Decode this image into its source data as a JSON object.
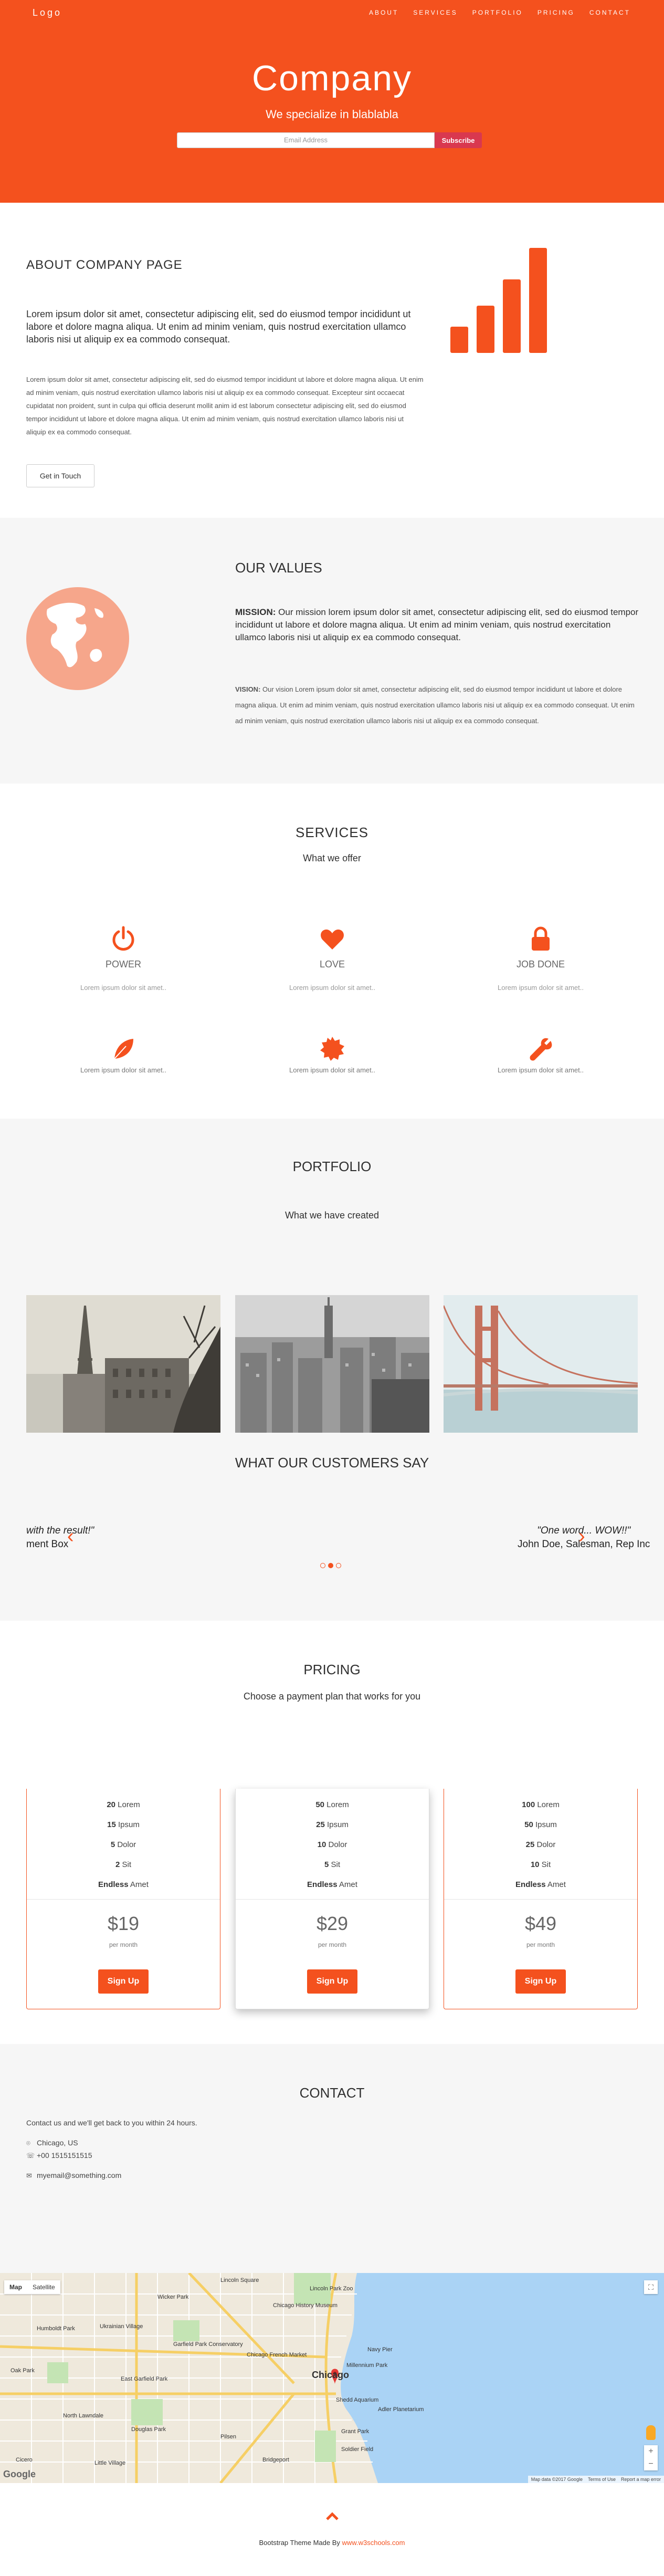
{
  "nav": {
    "logo": "Logo",
    "links": [
      "ABOUT",
      "SERVICES",
      "PORTFOLIO",
      "PRICING",
      "CONTACT"
    ]
  },
  "hero": {
    "title": "Company",
    "tagline": "We specialize in blablabla",
    "email_placeholder": "Email Address",
    "subscribe_label": "Subscribe"
  },
  "about": {
    "title": "ABOUT COMPANY PAGE",
    "lead": "Lorem ipsum dolor sit amet, consectetur adipiscing elit, sed do eiusmod tempor incididunt ut labore et dolore magna aliqua. Ut enim ad minim veniam, quis nostrud exercitation ullamco laboris nisi ut aliquip ex ea commodo consequat.",
    "body": "Lorem ipsum dolor sit amet, consectetur adipiscing elit, sed do eiusmod tempor incididunt ut labore et dolore magna aliqua. Ut enim ad minim veniam, quis nostrud exercitation ullamco laboris nisi ut aliquip ex ea commodo consequat. Excepteur sint occaecat cupidatat non proident, sunt in culpa qui officia deserunt mollit anim id est laborum consectetur adipiscing elit, sed do eiusmod tempor incididunt ut labore et dolore magna aliqua. Ut enim ad minim veniam, quis nostrud exercitation ullamco laboris nisi ut aliquip ex ea commodo consequat.",
    "button_label": "Get in Touch",
    "icon": "signal-icon"
  },
  "values": {
    "title": "OUR VALUES",
    "mission_label": "MISSION:",
    "mission_text": " Our mission lorem ipsum dolor sit amet, consectetur adipiscing elit, sed do eiusmod tempor incididunt ut labore et dolore magna aliqua. Ut enim ad minim veniam, quis nostrud exercitation ullamco laboris nisi ut aliquip ex ea commodo consequat.",
    "vision_label": "VISION:",
    "vision_text": " Our vision Lorem ipsum dolor sit amet, consectetur adipiscing elit, sed do eiusmod tempor incididunt ut labore et dolore magna aliqua. Ut enim ad minim veniam, quis nostrud exercitation ullamco laboris nisi ut aliquip ex ea commodo consequat. Ut enim ad minim veniam, quis nostrud exercitation ullamco laboris nisi ut aliquip ex ea commodo consequat.",
    "icon": "globe-icon"
  },
  "services": {
    "title": "SERVICES",
    "subtitle": "What we offer",
    "items": [
      {
        "icon": "power-icon",
        "title": "POWER",
        "text": "Lorem ipsum dolor sit amet.."
      },
      {
        "icon": "heart-icon",
        "title": "LOVE",
        "text": "Lorem ipsum dolor sit amet.."
      },
      {
        "icon": "lock-icon",
        "title": "JOB DONE",
        "text": "Lorem ipsum dolor sit amet.."
      },
      {
        "icon": "leaf-icon",
        "title": "",
        "text": "Lorem ipsum dolor sit amet.."
      },
      {
        "icon": "certificate-icon",
        "title": "",
        "text": "Lorem ipsum dolor sit amet.."
      },
      {
        "icon": "wrench-icon",
        "title": "",
        "text": "Lorem ipsum dolor sit amet.."
      }
    ]
  },
  "portfolio": {
    "title": "PORTFOLIO",
    "subtitle": "What we have created",
    "images": [
      "paris-photo",
      "new-york-photo",
      "san-francisco-photo"
    ],
    "customers_title": "WHAT OUR CUSTOMERS SAY",
    "quote_left_line1": "with the result!\"",
    "quote_left_line2": "ment Box",
    "quote_right_line1": "\"One word... WOW!!\"",
    "quote_right_line2": "John Doe, Salesman, Rep Inc"
  },
  "pricing": {
    "title": "PRICING",
    "subtitle": "Choose a payment plan that works for you",
    "plans": [
      {
        "f1n": "20",
        "f1": " Lorem",
        "f2n": "15",
        "f2": " Ipsum",
        "f3n": "5",
        "f3": " Dolor",
        "f4n": "2",
        "f4": " Sit",
        "f5n": "Endless",
        "f5": " Amet",
        "price": "$19",
        "per": "per month",
        "button": "Sign Up"
      },
      {
        "f1n": "50",
        "f1": " Lorem",
        "f2n": "25",
        "f2": " Ipsum",
        "f3n": "10",
        "f3": " Dolor",
        "f4n": "5",
        "f4": " Sit",
        "f5n": "Endless",
        "f5": " Amet",
        "price": "$29",
        "per": "per month",
        "button": "Sign Up"
      },
      {
        "f1n": "100",
        "f1": " Lorem",
        "f2n": "50",
        "f2": " Ipsum",
        "f3n": "25",
        "f3": " Dolor",
        "f4n": "10",
        "f4": " Sit",
        "f5n": "Endless",
        "f5": " Amet",
        "price": "$49",
        "per": "per month",
        "button": "Sign Up"
      }
    ]
  },
  "contact": {
    "title": "CONTACT",
    "intro": "Contact us and we'll get back to you within 24 hours.",
    "location": "Chicago, US",
    "phone": "+00 1515151515",
    "email": "myemail@something.com"
  },
  "map": {
    "tab_map": "Map",
    "tab_satellite": "Satellite",
    "city": "Chicago",
    "labels": [
      "Lincoln Park Zoo",
      "Chicago History Museum",
      "Navy Pier",
      "Millennium Park",
      "Shedd Aquarium",
      "Adler Planetarium",
      "Grant Park",
      "Garfield Park Conservatory",
      "Douglas Park",
      "Little Village",
      "Ukrainian Village",
      "Wicker Park",
      "Humboldt Park",
      "East Garfield Park",
      "North Lawndale",
      "Pilsen",
      "Bridgeport",
      "Chicago French Market",
      "Soldier Field",
      "Lincoln Square",
      "Cicero",
      "Oak Park"
    ],
    "footer": [
      "Map data ©2017 Google",
      "Terms of Use",
      "Report a map error"
    ],
    "google": "Google"
  },
  "footer": {
    "made_by": "Bootstrap Theme Made By ",
    "link": "www.w3schools.com"
  },
  "colors": {
    "accent": "#f4511e",
    "light_accent": "#f6a68b",
    "section_bg": "#f6f6f6"
  }
}
